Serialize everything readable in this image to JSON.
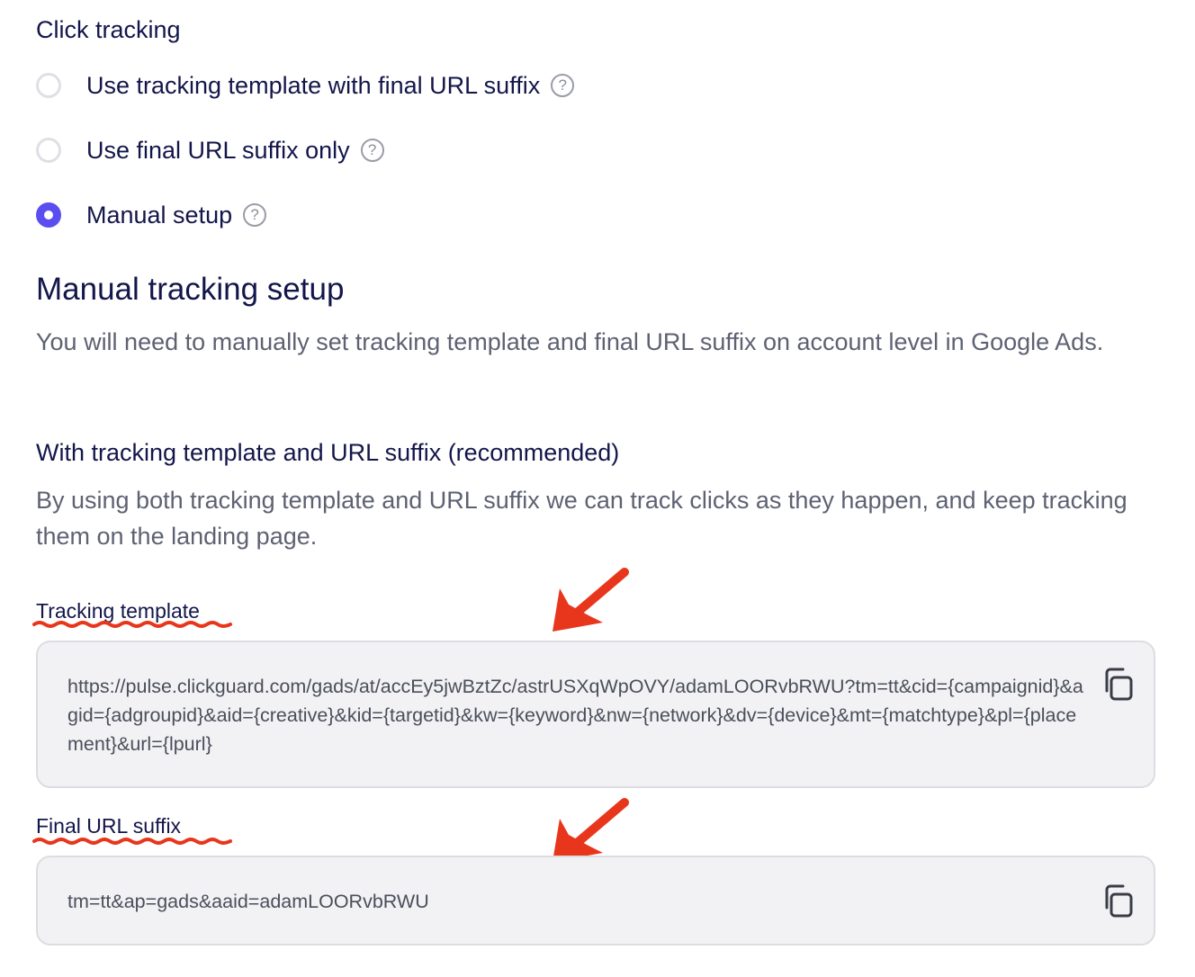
{
  "click_tracking": {
    "title": "Click tracking",
    "options": [
      {
        "label": "Use tracking template with final URL suffix",
        "selected": false
      },
      {
        "label": "Use final URL suffix only",
        "selected": false
      },
      {
        "label": "Manual setup",
        "selected": true
      }
    ],
    "help_glyph": "?"
  },
  "manual_setup": {
    "title": "Manual tracking setup",
    "description": "You will need to manually set tracking template and final URL suffix on account level in Google Ads."
  },
  "recommended": {
    "title": "With tracking template and URL suffix (recommended)",
    "description": "By using both tracking template and URL suffix we can track clicks as they happen, and keep tracking them on the landing page."
  },
  "tracking_template": {
    "label": "Tracking template",
    "value": "https://pulse.clickguard.com/gads/at/accEy5jwBztZc/astrUSXqWpOVY/adamLOORvbRWU?tm=tt&cid={campaignid}&agid={adgroupid}&aid={creative}&kid={targetid}&kw={keyword}&nw={network}&dv={device}&mt={matchtype}&pl={placement}&url={lpurl}"
  },
  "final_url_suffix": {
    "label": "Final URL suffix",
    "value": "tm=tt&ap=gads&aaid=adamLOORvbRWU"
  },
  "colors": {
    "accent": "#5b4ef0",
    "annotation": "#e8361c",
    "heading": "#13164a",
    "body_text": "#5e6172",
    "field_bg": "#f2f2f4"
  }
}
